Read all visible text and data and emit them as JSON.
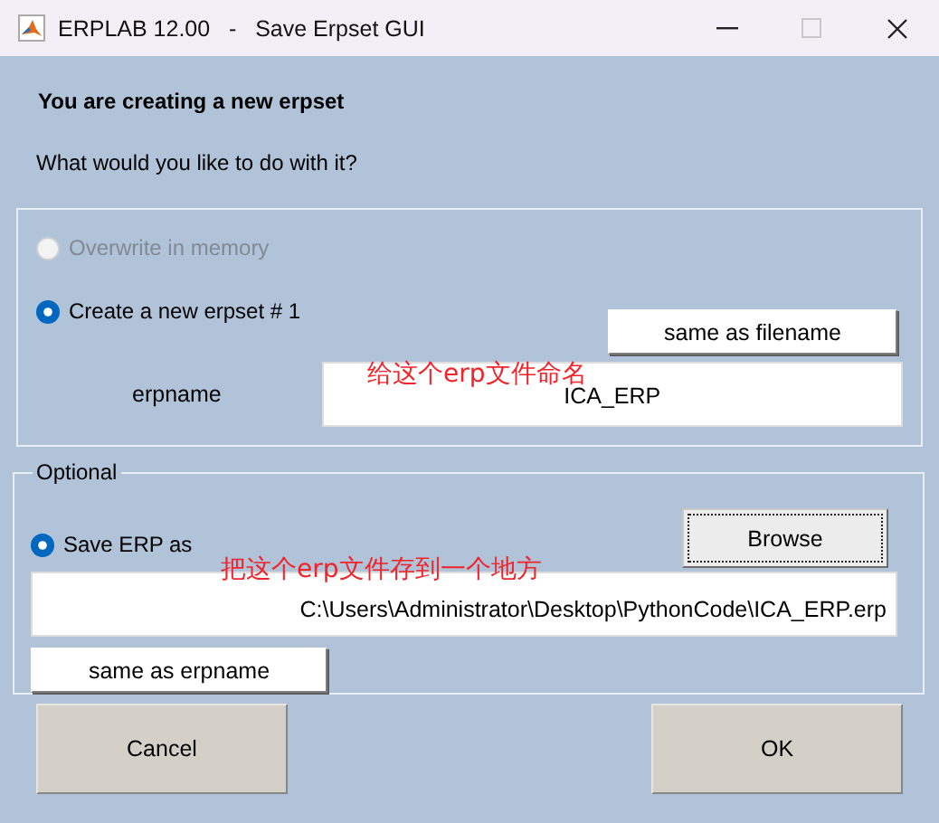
{
  "window": {
    "title": "ERPLAB 12.00   -   Save Erpset GUI",
    "controls": [
      {
        "kind": "minimize",
        "disabled": false
      },
      {
        "kind": "maximize",
        "disabled": true
      },
      {
        "kind": "close",
        "disabled": false
      }
    ]
  },
  "heading": "You are creating a new erpset",
  "question": "What would you like to do with it?",
  "erpset_panel": {
    "options": [
      {
        "label": "Overwrite in memory",
        "selected": false,
        "disabled": true
      },
      {
        "label": "Create a new erpset # 1",
        "selected": true,
        "disabled": false
      }
    ],
    "same_as_filename_button": "same as filename",
    "erpname_label": "erpname",
    "erpname_value": "ICA_ERP",
    "annotation": "给这个erp文件命名"
  },
  "optional_panel": {
    "legend": "Optional",
    "save_option": {
      "label": "Save ERP as",
      "selected": true,
      "disabled": false
    },
    "browse_button": "Browse",
    "annotation": "把这个erp文件存到一个地方",
    "path_value": "C:\\Users\\Administrator\\Desktop\\PythonCode\\ICA_ERP.erp",
    "same_as_erpname_button": "same as erpname"
  },
  "buttons": [
    "Cancel",
    "OK"
  ]
}
